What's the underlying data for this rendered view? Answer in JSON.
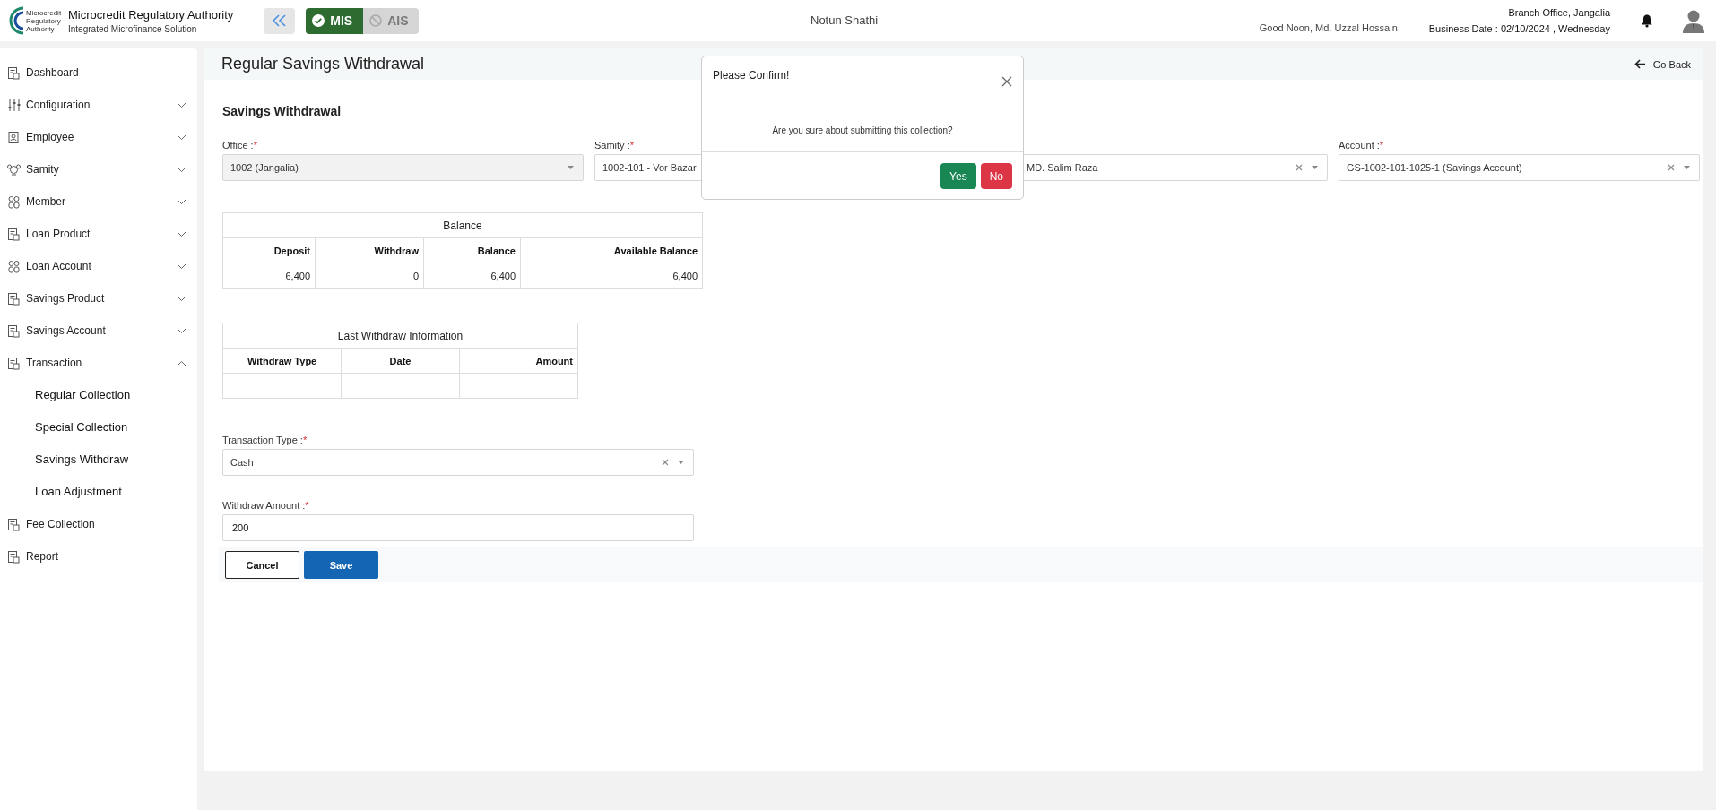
{
  "header": {
    "org_title": "Microcredit Regulatory Authority",
    "org_subtitle": "Integrated Microfinance Solution",
    "logo_text": [
      "Microcredit",
      "Regulatory",
      "Authority"
    ],
    "modules": [
      {
        "label": "MIS",
        "selected": true
      },
      {
        "label": "AIS",
        "selected": false
      }
    ],
    "app_name": "Notun Shathi",
    "greeting": "Good Noon, Md. Uzzal Hossain",
    "branch": "Branch Office, Jangalia",
    "business_date": "Business Date : 02/10/2024 , Wednesday"
  },
  "sidebar": {
    "items": [
      {
        "label": "Dashboard"
      },
      {
        "label": "Configuration",
        "expanded": false
      },
      {
        "label": "Employee",
        "expanded": false
      },
      {
        "label": "Samity",
        "expanded": false
      },
      {
        "label": "Member",
        "expanded": false
      },
      {
        "label": "Loan Product",
        "expanded": false
      },
      {
        "label": "Loan Account",
        "expanded": false
      },
      {
        "label": "Savings Product",
        "expanded": false
      },
      {
        "label": "Savings Account",
        "expanded": false
      },
      {
        "label": "Transaction",
        "expanded": true,
        "children": [
          {
            "label": "Regular Collection"
          },
          {
            "label": "Special Collection"
          },
          {
            "label": "Savings Withdraw"
          },
          {
            "label": "Loan Adjustment"
          }
        ]
      },
      {
        "label": "Fee Collection"
      },
      {
        "label": "Report"
      }
    ]
  },
  "page": {
    "title": "Regular Savings Withdrawal",
    "go_back": "Go Back",
    "section_title": "Savings Withdrawal",
    "fields": [
      {
        "label": "Office :",
        "required_mark": "*",
        "value": "1002 (Jangalia)",
        "disabled": true,
        "clearable": false
      },
      {
        "label": "Samity :",
        "required_mark": "*",
        "value": "1002-101 - Vor Bazar",
        "disabled": false
      },
      {
        "value": "MD. Salim Raza",
        "disabled": false,
        "clearable": true
      },
      {
        "label": "Account :",
        "required_mark": "*",
        "value": "GS-1002-101-1025-1 (Savings Account)",
        "disabled": false,
        "clearable": true
      }
    ],
    "balance_table": {
      "title": "Balance",
      "columns": [
        "Deposit",
        "Withdraw",
        "Balance",
        "Available Balance"
      ],
      "rows": [
        [
          "6,400",
          "0",
          "6,400",
          "6,400"
        ]
      ]
    },
    "last_withdraw_table": {
      "title": "Last Withdraw Information",
      "columns": [
        "Withdraw Type",
        "Date",
        "Amount"
      ],
      "rows": [
        [
          "",
          "",
          ""
        ]
      ]
    },
    "transaction_type": {
      "label": "Transaction Type :",
      "required_mark": "*",
      "value": "Cash",
      "clearable": true
    },
    "withdraw_amount": {
      "label": "Withdraw Amount :",
      "required_mark": "*",
      "value": "200"
    },
    "buttons": [
      {
        "label": "Cancel",
        "kind": "secondary"
      },
      {
        "label": "Save",
        "kind": "primary"
      }
    ]
  },
  "dialog": {
    "title": "Please Confirm!",
    "message": "Are you sure about submitting this collection?",
    "buttons": [
      {
        "label": "Yes",
        "kind": "confirm"
      },
      {
        "label": "No",
        "kind": "cancel"
      }
    ]
  }
}
